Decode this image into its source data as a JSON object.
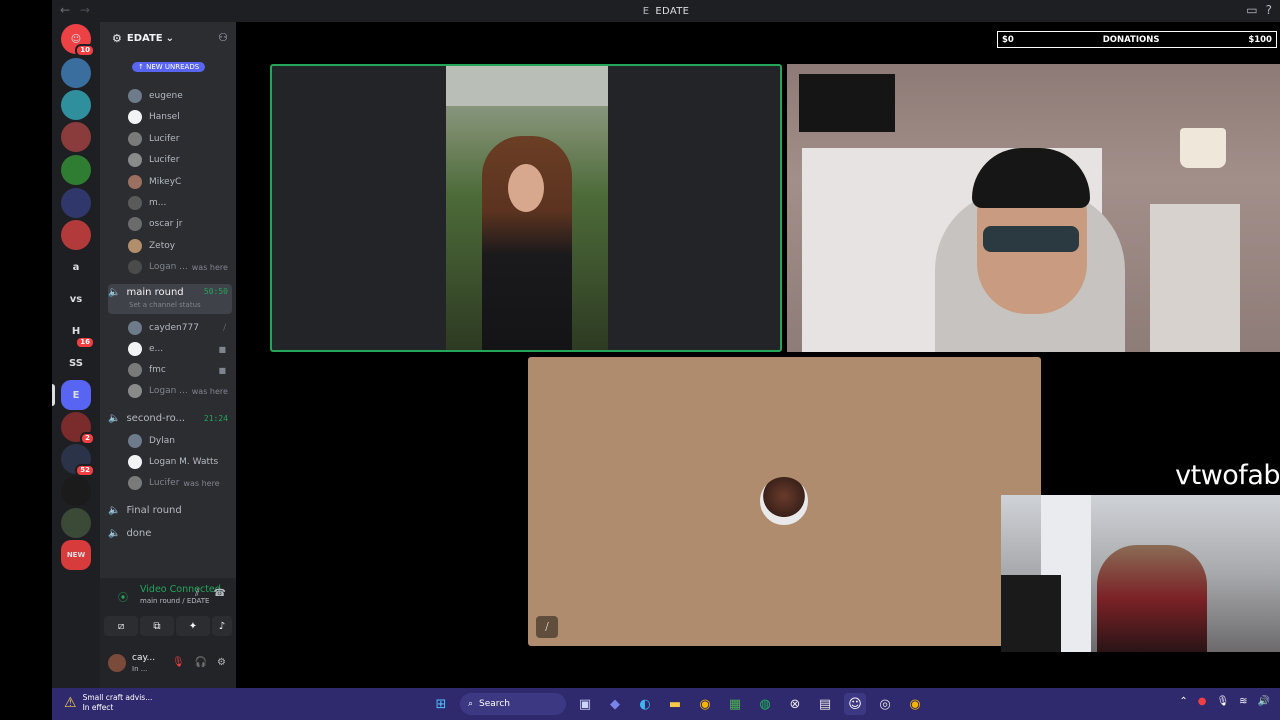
{
  "window": {
    "title": "EDATE",
    "title_glyph": "E",
    "nav_back": "←",
    "nav_forward": "→"
  },
  "colors": {
    "accent_green": "#23a55a",
    "discord_red": "#f23f43",
    "sidebar": "#2b2d31",
    "rail": "#1e1f22",
    "taskbar": "#2f2a6e"
  },
  "rail": {
    "items": [
      {
        "label": "",
        "badge": "10",
        "icon": "discord-home-icon"
      },
      {
        "label": "",
        "badge": "",
        "icon": "server-icon"
      },
      {
        "label": "",
        "badge": "",
        "icon": "server-icon"
      },
      {
        "label": "",
        "badge": "",
        "icon": "server-icon"
      },
      {
        "label": "",
        "badge": "",
        "icon": "server-icon"
      },
      {
        "label": "",
        "badge": "",
        "icon": "server-icon"
      },
      {
        "label": "",
        "badge": "",
        "icon": "server-icon"
      },
      {
        "label": "a",
        "badge": "",
        "icon": ""
      },
      {
        "label": "vs",
        "badge": "",
        "icon": ""
      },
      {
        "label": "H",
        "badge": "16",
        "icon": ""
      },
      {
        "label": "SS",
        "badge": "",
        "icon": ""
      },
      {
        "label": "E",
        "badge": "",
        "icon": ""
      },
      {
        "label": "",
        "badge": "2",
        "icon": "server-icon"
      },
      {
        "label": "",
        "badge": "52",
        "icon": "server-icon"
      },
      {
        "label": "",
        "badge": "",
        "icon": "server-icon"
      },
      {
        "label": "",
        "badge": "",
        "icon": "server-icon"
      },
      {
        "label": "NEW",
        "badge": "",
        "icon": ""
      }
    ]
  },
  "sidebar": {
    "server_name": "EDATE",
    "new_unreads": "NEW UNREADS",
    "members_top": [
      {
        "name": "eugene",
        "was_here": ""
      },
      {
        "name": "Hansel",
        "was_here": ""
      },
      {
        "name": "Lucifer",
        "was_here": ""
      },
      {
        "name": "Lucifer",
        "was_here": ""
      },
      {
        "name": "MikeyC",
        "was_here": ""
      },
      {
        "name": "m...",
        "was_here": ""
      },
      {
        "name": "oscar jr",
        "was_here": ""
      },
      {
        "name": "Zetoy",
        "was_here": ""
      },
      {
        "name": "Logan ...",
        "was_here": "was here"
      }
    ],
    "channels": [
      {
        "name": "main round",
        "time": "50:50",
        "status": "Set a channel status"
      },
      {
        "name": "second-ro...",
        "time": "21:24",
        "status": ""
      },
      {
        "name": "Final round",
        "time": "",
        "status": ""
      },
      {
        "name": "done",
        "time": "",
        "status": ""
      }
    ],
    "members_main": [
      {
        "name": "cayden777",
        "was_here": ""
      },
      {
        "name": "e...",
        "was_here": ""
      },
      {
        "name": "fmc",
        "was_here": ""
      },
      {
        "name": "Logan ...",
        "was_here": "was here"
      }
    ],
    "members_second": [
      {
        "name": "Dylan",
        "was_here": ""
      },
      {
        "name": "Logan M. Watts",
        "was_here": ""
      },
      {
        "name": "Lucifer",
        "was_here": "was here"
      }
    ]
  },
  "voice": {
    "status": "Video Connected",
    "location": "main round / EDATE"
  },
  "user": {
    "name": "cay...",
    "status": "In ..."
  },
  "donations": {
    "left": "$0",
    "label": "DONATIONS",
    "right": "$100",
    "progress": 0
  },
  "stream": {
    "streamer_name": "vtwofab"
  },
  "taskbar": {
    "weather_title": "Small craft advis...",
    "weather_sub": "In effect",
    "search": "Search"
  }
}
